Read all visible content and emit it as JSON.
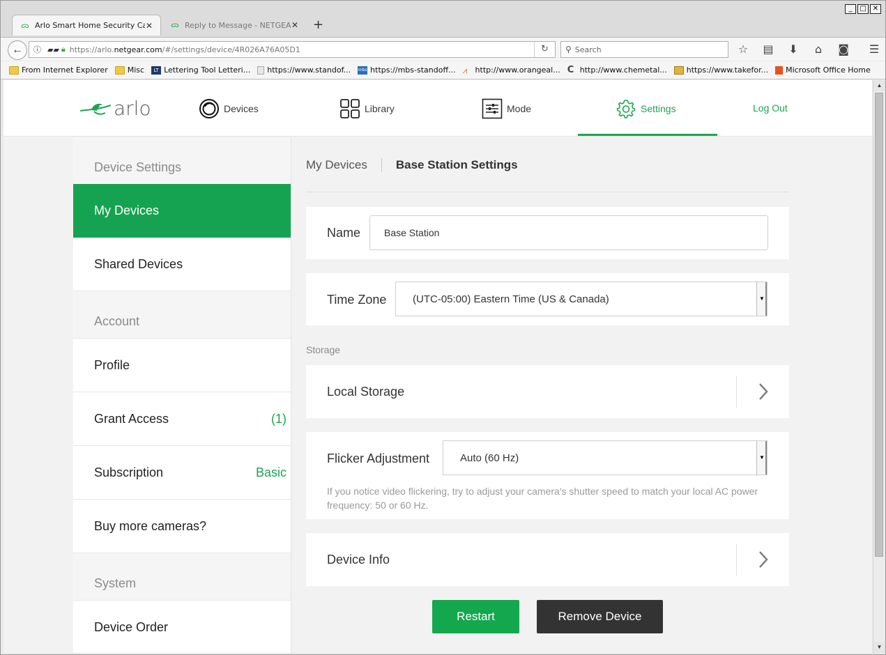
{
  "browser": {
    "tabs": [
      {
        "title": "Arlo Smart Home Security Ca...",
        "active": true
      },
      {
        "title": "Reply to Message - NETGEAR...",
        "active": false
      }
    ],
    "url_prefix": "https://arlo.",
    "url_domain": "netgear.com",
    "url_path": "/#/settings/device/4R026A76A05D1",
    "search_placeholder": "Search",
    "bookmarks": [
      {
        "label": "From Internet Explorer",
        "icon": "folder"
      },
      {
        "label": "Misc",
        "icon": "folder"
      },
      {
        "label": "Lettering Tool  Letteri...",
        "icon": "lt"
      },
      {
        "label": "https://www.standof...",
        "icon": "doc"
      },
      {
        "label": "https://mbs-standoff...",
        "icon": "ms"
      },
      {
        "label": "http://www.orangeal...",
        "icon": "oa"
      },
      {
        "label": "http://www.chemetal...",
        "icon": "cc"
      },
      {
        "label": "https://www.takefor...",
        "icon": "tf"
      },
      {
        "label": "Microsoft Office Home",
        "icon": "office"
      }
    ]
  },
  "header": {
    "logo_text": "arlo",
    "nav": {
      "devices": "Devices",
      "library": "Library",
      "mode": "Mode",
      "settings": "Settings",
      "logout": "Log Out"
    },
    "accent_color": "#1ea451"
  },
  "sidebar": {
    "device_settings_header": "Device Settings",
    "my_devices": "My Devices",
    "shared_devices": "Shared Devices",
    "account_header": "Account",
    "profile": "Profile",
    "grant_access": "Grant Access",
    "grant_access_count": "(1)",
    "subscription": "Subscription",
    "subscription_value": "Basic",
    "buy_more": "Buy more cameras?",
    "system_header": "System",
    "device_order": "Device Order"
  },
  "main": {
    "breadcrumb_link": "My Devices",
    "breadcrumb_current": "Base Station Settings",
    "name_label": "Name",
    "name_value": "Base Station",
    "timezone_label": "Time Zone",
    "timezone_value": "(UTC-05:00) Eastern Time (US & Canada)",
    "storage_section": "Storage",
    "local_storage": "Local Storage",
    "flicker_label": "Flicker Adjustment",
    "flicker_value": "Auto (60 Hz)",
    "flicker_help": "If you notice video flickering, try to adjust your camera's shutter speed to match your local AC power frequency: 50 or 60 Hz.",
    "device_info": "Device Info",
    "restart_button": "Restart",
    "remove_button": "Remove Device"
  }
}
